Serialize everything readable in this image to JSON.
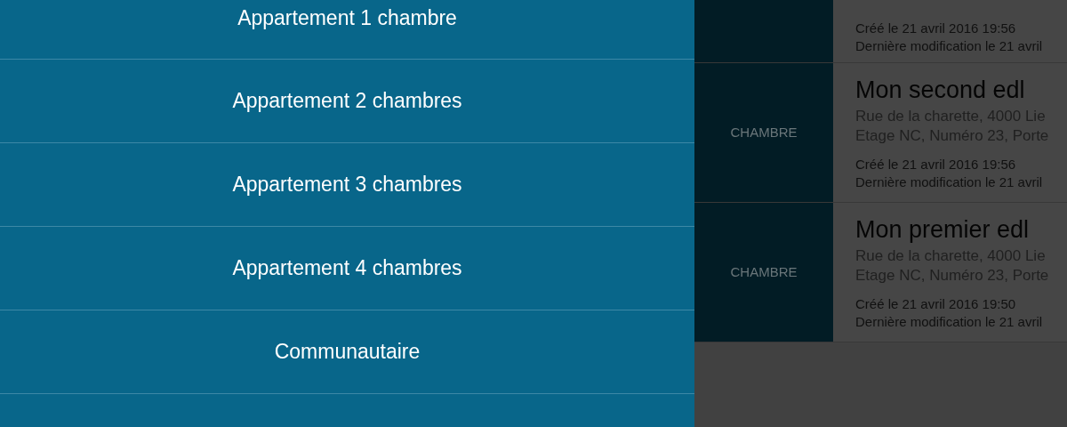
{
  "menu": {
    "items": [
      {
        "label": "Appartement 1 chambre"
      },
      {
        "label": "Appartement 2 chambres"
      },
      {
        "label": "Appartement 3 chambres"
      },
      {
        "label": "Appartement 4 chambres"
      },
      {
        "label": "Communautaire"
      }
    ]
  },
  "list": {
    "cards": [
      {
        "created": "Créé le 21 avril 2016 19:56",
        "modified": "Dernière modification le 21 avril"
      },
      {
        "type": "CHAMBRE",
        "title": "Mon second edl",
        "address": "Rue de la charette, 4000 Lie",
        "details": "Etage NC, Numéro 23, Porte",
        "created": "Créé le 21 avril 2016 19:56",
        "modified": "Dernière modification le 21 avril"
      },
      {
        "type": "CHAMBRE",
        "title": "Mon premier edl",
        "address": "Rue de la charette, 4000 Lie",
        "details": "Etage NC, Numéro 23, Porte",
        "created": "Créé le 21 avril 2016 19:50",
        "modified": "Dernière modification le 21 avril"
      }
    ]
  }
}
